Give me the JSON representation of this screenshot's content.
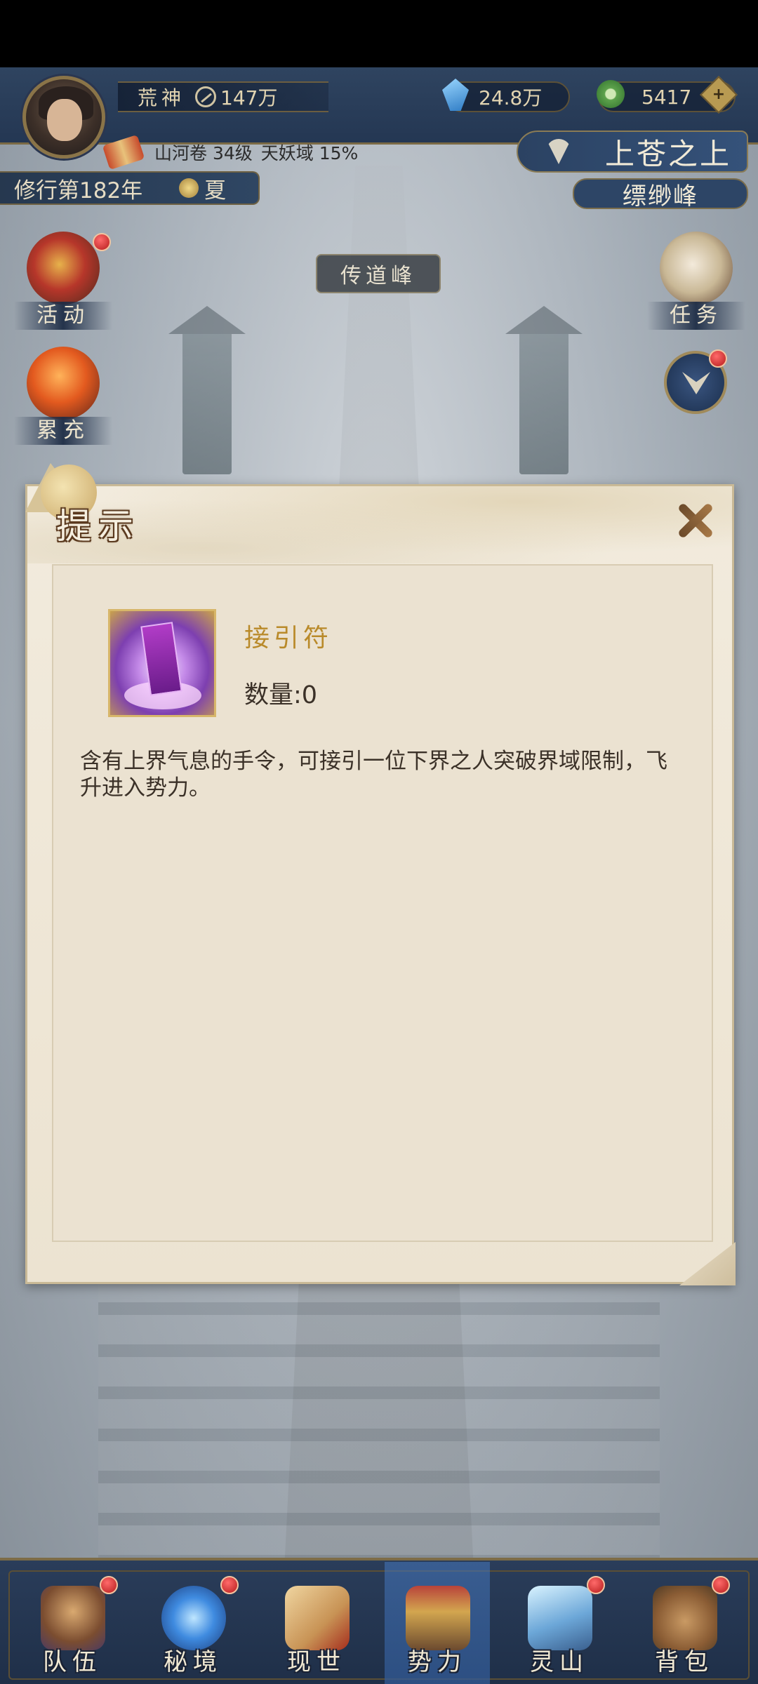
{
  "header": {
    "rank_title": "荒神",
    "power_value": "147万",
    "spirit_stones": "24.8万",
    "jade": "5417",
    "plus_label": "+",
    "sub_info": [
      "山河卷 34级",
      "天妖域 15%"
    ],
    "cultivation_year": "修行第182年",
    "season": "夏",
    "location_main": "上苍之上",
    "location_sub": "缥缈峰"
  },
  "side_buttons": {
    "activity": "活动",
    "recharge": "累充",
    "quest": "任务"
  },
  "scene": {
    "peak_label": "传道峰"
  },
  "dialog": {
    "title": "提示",
    "item_name": "接引符",
    "item_quantity": "数量:0",
    "item_description": "含有上界气息的手令，可接引一位下界之人突破界域限制，飞升进入势力。"
  },
  "bottom_nav": {
    "items": [
      {
        "label": "队伍",
        "icon": "team-icon",
        "badge": true
      },
      {
        "label": "秘境",
        "icon": "secret-realm-icon",
        "badge": true
      },
      {
        "label": "现世",
        "icon": "world-scroll-icon",
        "badge": false
      },
      {
        "label": "势力",
        "icon": "sect-palace-icon",
        "badge": false,
        "active": true
      },
      {
        "label": "灵山",
        "icon": "spirit-mountain-icon",
        "badge": true
      },
      {
        "label": "背包",
        "icon": "bag-icon",
        "badge": true
      }
    ]
  },
  "colors": {
    "top_bar": "#2f4460",
    "dialog_bg": "#f2ebdd",
    "item_name": "#b98a2a",
    "badge_red": "#b51c1c",
    "nav_active": "#4678be"
  }
}
